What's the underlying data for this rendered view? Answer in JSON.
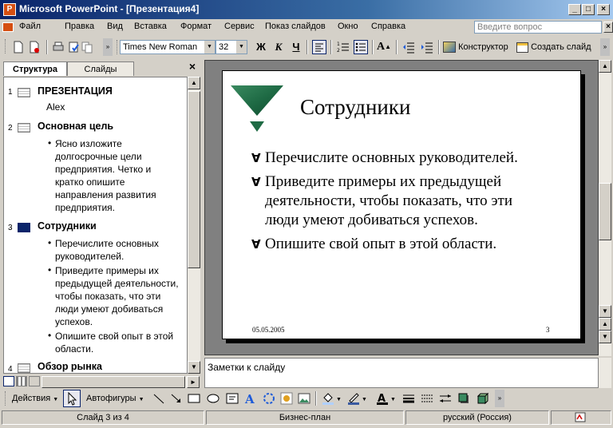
{
  "window": {
    "title": "Microsoft PowerPoint - [Презентация4]"
  },
  "menu": {
    "items": [
      "Файл",
      "Правка",
      "Вид",
      "Вставка",
      "Формат",
      "Сервис",
      "Показ слайдов",
      "Окно",
      "Справка"
    ],
    "ask_placeholder": "Введите вопрос"
  },
  "toolbar": {
    "font_name": "Times New Roman",
    "font_size": "32",
    "bold": "Ж",
    "italic": "К",
    "underline": "Ч",
    "design_label": "Конструктор",
    "new_slide_label": "Создать слайд"
  },
  "pane_tabs": {
    "structure": "Структура",
    "slides": "Слайды",
    "close": "×"
  },
  "outline": [
    {
      "num": "1",
      "title": "ПРЕЗЕНТАЦИЯ",
      "subtitle": "Alex",
      "bullets": []
    },
    {
      "num": "2",
      "title": "Основная цель",
      "bullets": [
        "Ясно изложите долгосрочные цели предприятия. Четко и кратко опишите направления развития предприятия."
      ]
    },
    {
      "num": "3",
      "title": "Сотрудники",
      "bullets": [
        "Перечислите основных руководителей.",
        "Приведите примеры их предыдущей деятельности, чтобы показать, что эти люди умеют добиваться успехов.",
        "Опишите свой опыт в этой области."
      ]
    },
    {
      "num": "4",
      "title": "Обзор рынка",
      "bullets": []
    }
  ],
  "outline_lines": {
    "s2": [
      "Ясно изложите",
      "долгосрочные цели",
      "предприятия. Четко и",
      "кратко опишите",
      "направления развития",
      "предприятия."
    ],
    "s3b1": [
      "Перечислите основных",
      "руководителей."
    ],
    "s3b2": [
      "Приведите примеры их",
      "предыдущей деятельности,",
      "чтобы показать, что эти",
      "люди умеют добиваться",
      "успехов."
    ],
    "s3b3": [
      "Опишите свой опыт в этой",
      "области."
    ]
  },
  "slide": {
    "title": "Сотрудники",
    "bullets": [
      "Перечислите основных руководителей.",
      "Приведите примеры их предыдущей деятельности, чтобы показать, что эти люди умеют добиваться успехов.",
      "Опишите свой опыт в этой области."
    ],
    "bullet_lines": [
      [
        "Перечислите основных руководителей."
      ],
      [
        "Приведите примеры их предыдущей",
        "деятельности, чтобы показать, что эти",
        "люди умеют добиваться успехов."
      ],
      [
        "Опишите свой опыт в этой области."
      ]
    ],
    "date": "05.05.2005",
    "number": "3",
    "accent_color": "#1f6b45"
  },
  "notes": {
    "placeholder": "Заметки к слайду"
  },
  "drawing": {
    "actions_label": "Действия",
    "autoshapes_label": "Автофигуры"
  },
  "status": {
    "slide_info": "Слайд 3 из 4",
    "design": "Бизнес-план",
    "language": "русский (Россия)"
  }
}
